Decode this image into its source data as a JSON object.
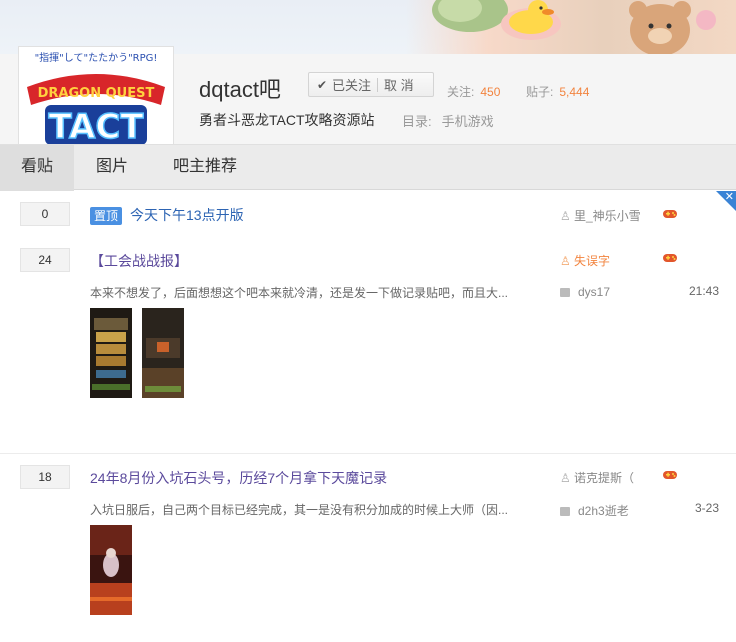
{
  "forum": {
    "logo_alt": "DRAGON QUEST TACT",
    "logo_tagline": "\"指揮\"して\"たたかう\"RPG!",
    "logo_title": "DRAGON QUEST",
    "logo_sub": "TACT",
    "title": "dqtact吧",
    "follow_label": "已关注",
    "cancel_label": "取 消",
    "stat_follow_label": "关注:",
    "stat_follow_value": "450",
    "stat_posts_label": "贴子:",
    "stat_posts_value": "5,444",
    "slogan": "勇者斗恶龙TACT攻略资源站",
    "directory_label": "目录:",
    "directory_value": "手机游戏"
  },
  "tabs": [
    {
      "label": "看贴",
      "active": true
    },
    {
      "label": "图片",
      "active": false
    },
    {
      "label": "吧主推荐",
      "active": false
    }
  ],
  "threads": [
    {
      "replies": "0",
      "pinned_badge": "置顶",
      "title": "今天下午13点开版",
      "author": "里_神乐小雪",
      "author_color": "gray"
    },
    {
      "replies": "24",
      "title": "【工会战战报】",
      "author": "失误字",
      "author_color": "orange",
      "abstract": "本来不想发了，后面想想这个吧本来就冷清，还是发一下做记录贴吧，而且大...",
      "last_replier": "dys17",
      "time": "21:43"
    },
    {
      "replies": "18",
      "title": "24年8月份入坑石头号，历经7个月拿下天魔记录",
      "author": "诺克提斯（",
      "author_color": "gray",
      "abstract": "入坑日服后，自己两个目标已经完成，其一是没有积分加成的时候上大师（因...",
      "last_replier": "d2h3逝老",
      "time": "3-23"
    }
  ],
  "colors": {
    "link_blue": "#2d64b3",
    "visited_purple": "#5b4a9c",
    "stat_orange": "#f2843f",
    "pin_blue": "#4a90e2"
  }
}
